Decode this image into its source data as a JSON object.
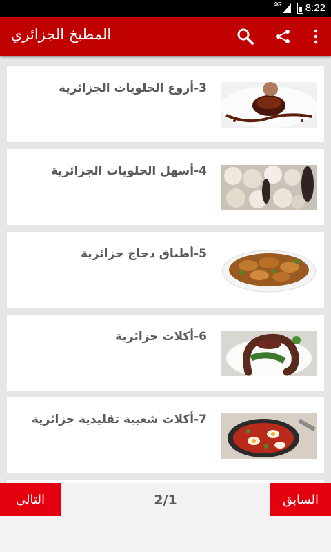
{
  "status_bar": {
    "network": "4G",
    "time": "8:22"
  },
  "app_bar": {
    "title": "المطبخ الجزائري",
    "icons": [
      "search-icon",
      "share-icon",
      "more-vert-icon"
    ]
  },
  "items": [
    {
      "label": "3-أروع الحلويات الجزائرية",
      "thumb": "dessert-plate"
    },
    {
      "label": "4-أسهل الحلويات الجزائرية",
      "thumb": "cookies-tray"
    },
    {
      "label": "5-أطباق دجاج جزائرية",
      "thumb": "chicken-dish"
    },
    {
      "label": "6-أكلات جزائرية",
      "thumb": "sausage-plate"
    },
    {
      "label": "7-أكلات شعبية تقليدية جزائرية",
      "thumb": "tomato-egg-pan"
    }
  ],
  "footer": {
    "next_label": "التالى",
    "prev_label": "السابق",
    "page_indicator": "2/1"
  }
}
